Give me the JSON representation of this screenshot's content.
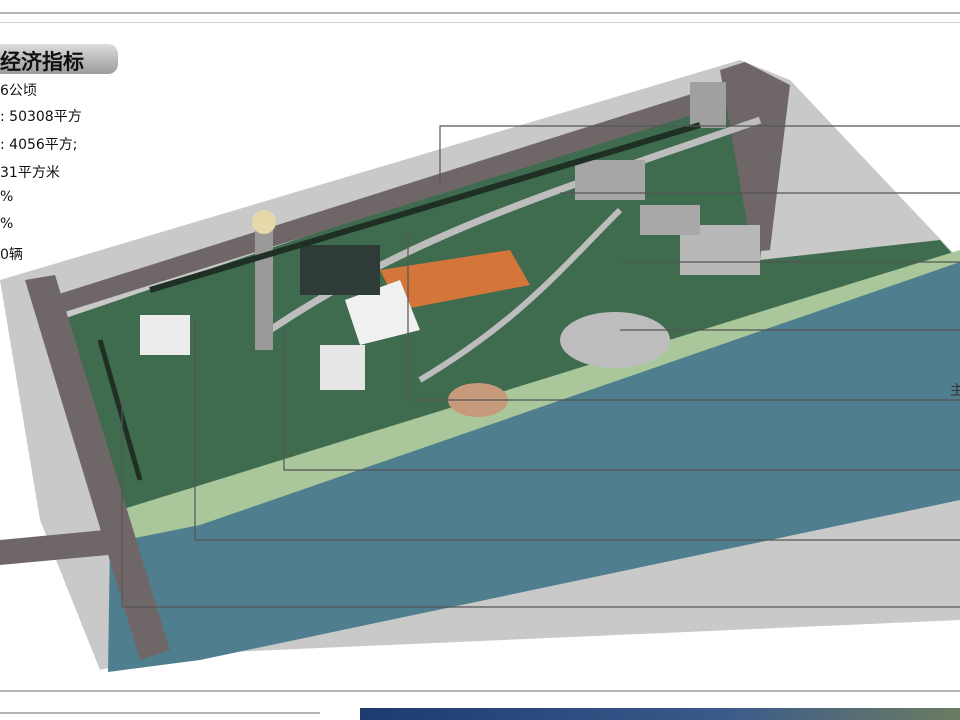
{
  "panel": {
    "title": "经济指标",
    "stats": [
      "6公顷",
      ": 50308平方",
      ": 4056平方;",
      "31平方米",
      "%",
      "%",
      "0辆"
    ],
    "edge_label": "主"
  },
  "colors": {
    "water": "#4f7f8f",
    "road": "#6f6668",
    "green": "#3f6b4f",
    "plaza": "#bdbdbd",
    "roof": "#d4763a"
  }
}
